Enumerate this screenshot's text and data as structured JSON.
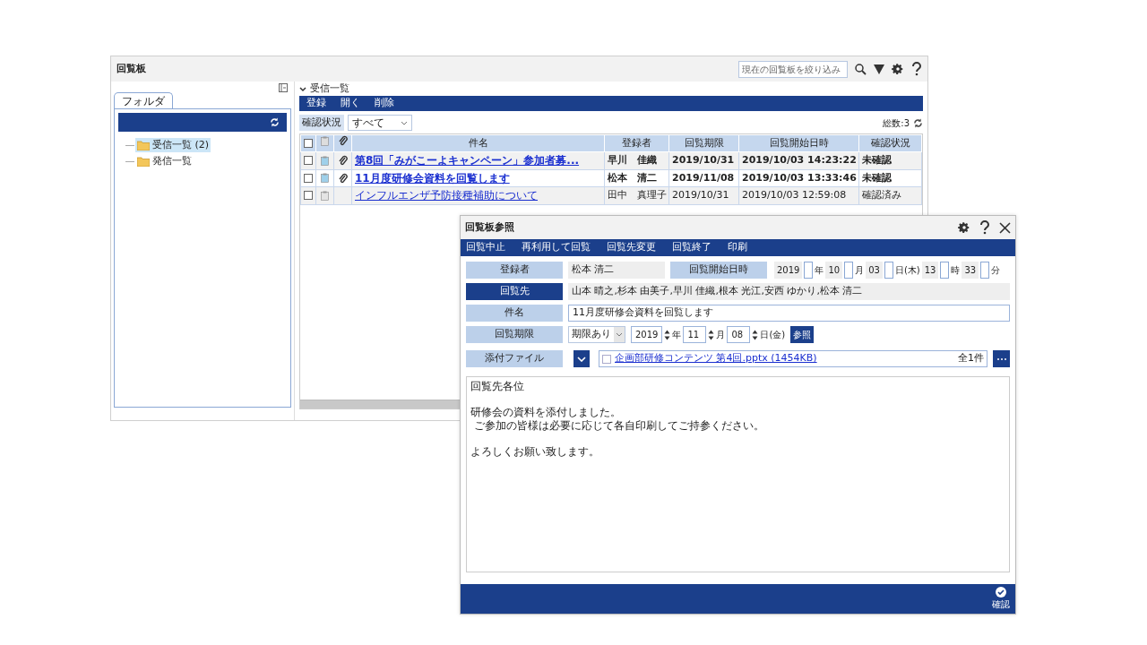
{
  "main_window": {
    "title": "回覧板",
    "search": {
      "placeholder": "現在の回覧板を絞り込み"
    }
  },
  "folder_tab": "フォルダ",
  "folders": [
    {
      "label": "受信一覧 (2)",
      "selected": true
    },
    {
      "label": "発信一覧",
      "selected": false
    }
  ],
  "list_heading": "受信一覧",
  "list_toolbar": [
    "登録",
    "開く",
    "削除"
  ],
  "filter": {
    "label": "確認状況",
    "value": "すべて"
  },
  "total": "総数:3",
  "table": {
    "select_all_checked": false,
    "columns": [
      "件名",
      "登録者",
      "回覧期限",
      "回覧開始日時",
      "確認状況"
    ],
    "rows": [
      {
        "checked": false,
        "unread": true,
        "attachment": true,
        "cells": [
          "第8回「みがこーよキャンペーン」参加者募...",
          "早川　佳織",
          "2019/10/31",
          "2019/10/03 14:23:22",
          "未確認"
        ]
      },
      {
        "checked": false,
        "unread": true,
        "attachment": true,
        "cells": [
          "11月度研修会資料を回覧します",
          "松本　清二",
          "2019/11/08",
          "2019/10/03 13:33:46",
          "未確認"
        ]
      },
      {
        "checked": false,
        "unread": false,
        "attachment": false,
        "cells": [
          "インフルエンザ予防接種補助について",
          "田中　真理子",
          "2019/10/31",
          "2019/10/03 12:59:08",
          "確認済み"
        ]
      }
    ]
  },
  "dialog": {
    "title": "回覧板参照",
    "toolbar": [
      "回覧中止",
      "再利用して回覧",
      "回覧先変更",
      "回覧終了",
      "印刷"
    ],
    "registrant": {
      "label": "登録者",
      "value": "松本 清二"
    },
    "start": {
      "label": "回覧開始日時",
      "parts": [
        {
          "value": "2019",
          "unit": "年"
        },
        {
          "value": "10",
          "unit": "月"
        },
        {
          "value": "03",
          "unit": "日(木)"
        },
        {
          "value": "13",
          "unit": "時"
        },
        {
          "value": "33",
          "unit": "分"
        }
      ]
    },
    "recipients": {
      "label": "回覧先",
      "value": "山本 晴之,杉本 由美子,早川 佳織,根本 光江,安西 ゆかり,松本 清二"
    },
    "subject": {
      "label": "件名",
      "value": "11月度研修会資料を回覧します"
    },
    "deadline": {
      "label": "回覧期限",
      "mode": "期限あり",
      "parts": [
        {
          "value": "2019",
          "unit": "年"
        },
        {
          "value": "11",
          "unit": "月"
        },
        {
          "value": "08",
          "unit": "日(金)"
        }
      ],
      "lookup": "参照"
    },
    "attachment": {
      "label": "添付ファイル",
      "file": "企画部研修コンテンツ 第4回.pptx (1454KB)",
      "file_checked": false,
      "count": "全1件"
    },
    "body": [
      [
        "回覧先各位"
      ],
      [
        "研修会の資料を添付しました。",
        " ご参加の皆様は必要に応じて各自印刷してご持参ください。"
      ],
      [
        "よろしくお願い致します。"
      ]
    ],
    "confirm": "確認"
  }
}
